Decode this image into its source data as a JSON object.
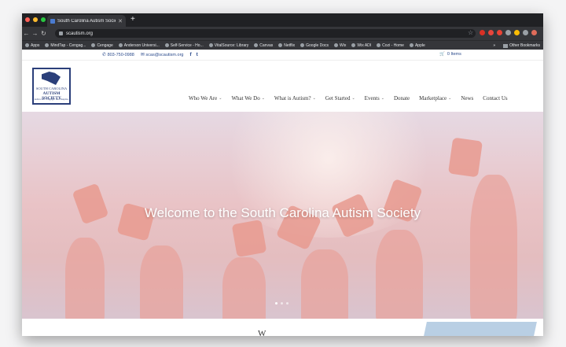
{
  "browser": {
    "tab_title": "South Carolina Autism Society",
    "url": "scautism.org",
    "bookmarks": [
      "Apps",
      "MindTap - Cengag...",
      "Cengage",
      "Anderson Universi...",
      "Self-Service - Ho...",
      "VitalSource: Library",
      "Canvas",
      "Netflix",
      "Google Docs",
      "Wix",
      "Wix ADI",
      "Cozi - Home",
      "Apple"
    ],
    "bookmarks_more": "»",
    "other_bookmarks": "Other Bookmarks",
    "colors": {
      "close": "#ff5f57",
      "minimize": "#febc2e",
      "maximize": "#28c840"
    }
  },
  "site": {
    "phone": "803-750-0988",
    "email": "scas@scautism.org",
    "social": [
      "f",
      "t"
    ],
    "cart": "0 Items",
    "logo": {
      "line1": "SOUTH CAROLINA",
      "line2": "AUTISM SOCIETY",
      "line3": "Advocate. Engage. and Inspire."
    },
    "nav": [
      {
        "label": "Who We Are",
        "dropdown": true
      },
      {
        "label": "What We Do",
        "dropdown": true
      },
      {
        "label": "What is Autism?",
        "dropdown": true
      },
      {
        "label": "Get Started",
        "dropdown": true
      },
      {
        "label": "Events",
        "dropdown": true
      },
      {
        "label": "Donate",
        "dropdown": false
      },
      {
        "label": "Marketplace",
        "dropdown": true
      },
      {
        "label": "News",
        "dropdown": false
      },
      {
        "label": "Contact Us",
        "dropdown": false
      }
    ],
    "hero_heading": "Welcome to the South Carolina Autism Society",
    "below_heading": "W"
  }
}
